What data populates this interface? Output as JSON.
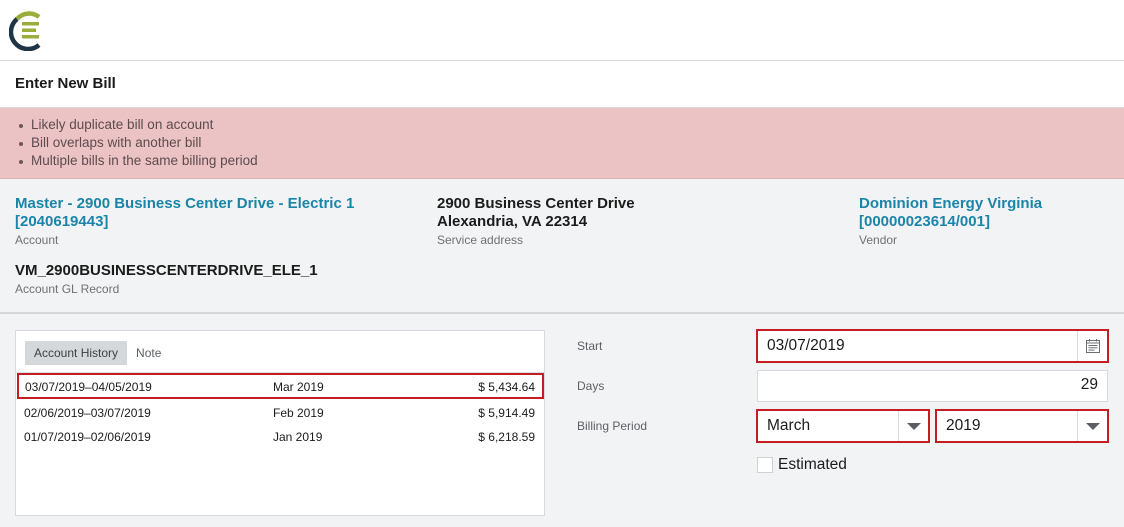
{
  "header": {
    "logo_name": "company-logo",
    "page_title": "Enter New Bill"
  },
  "alerts": [
    "Likely duplicate bill on account",
    "Bill overlaps with another bill",
    "Multiple bills in the same billing period"
  ],
  "account": {
    "name": "Master - 2900 Business Center Drive - Electric 1",
    "number": "[2040619443]",
    "label": "Account"
  },
  "service_address": {
    "line1": "2900 Business Center Drive",
    "line2": "Alexandria, VA 22314",
    "label": "Service address"
  },
  "vendor": {
    "name": "Dominion Energy Virginia",
    "number": "[00000023614/001]",
    "label": "Vendor"
  },
  "gl_record": {
    "value": "VM_2900BUSINESSCENTERDRIVE_ELE_1",
    "label": "Account GL Record"
  },
  "history": {
    "tabs": [
      {
        "label": "Account History",
        "active": true
      },
      {
        "label": "Note",
        "active": false
      }
    ],
    "rows": [
      {
        "range": "03/07/2019–04/05/2019",
        "period": "Mar 2019",
        "amount": "$ 5,434.64",
        "flagged": true
      },
      {
        "range": "02/06/2019–03/07/2019",
        "period": "Feb 2019",
        "amount": "$ 5,914.49",
        "flagged": false
      },
      {
        "range": "01/07/2019–02/06/2019",
        "period": "Jan 2019",
        "amount": "$ 6,218.59",
        "flagged": false
      }
    ]
  },
  "form": {
    "start_label": "Start",
    "start_value": "03/07/2019",
    "days_label": "Days",
    "days_value": "29",
    "billing_period_label": "Billing Period",
    "billing_month": "March",
    "billing_year": "2019",
    "estimated_label": "Estimated",
    "estimated_checked": false
  },
  "colors": {
    "brand_green": "#9aad3a",
    "brand_navy": "#1e3447",
    "link": "#1a85a8",
    "error": "#c41e24",
    "alert_bg": "#ecc3c4"
  }
}
